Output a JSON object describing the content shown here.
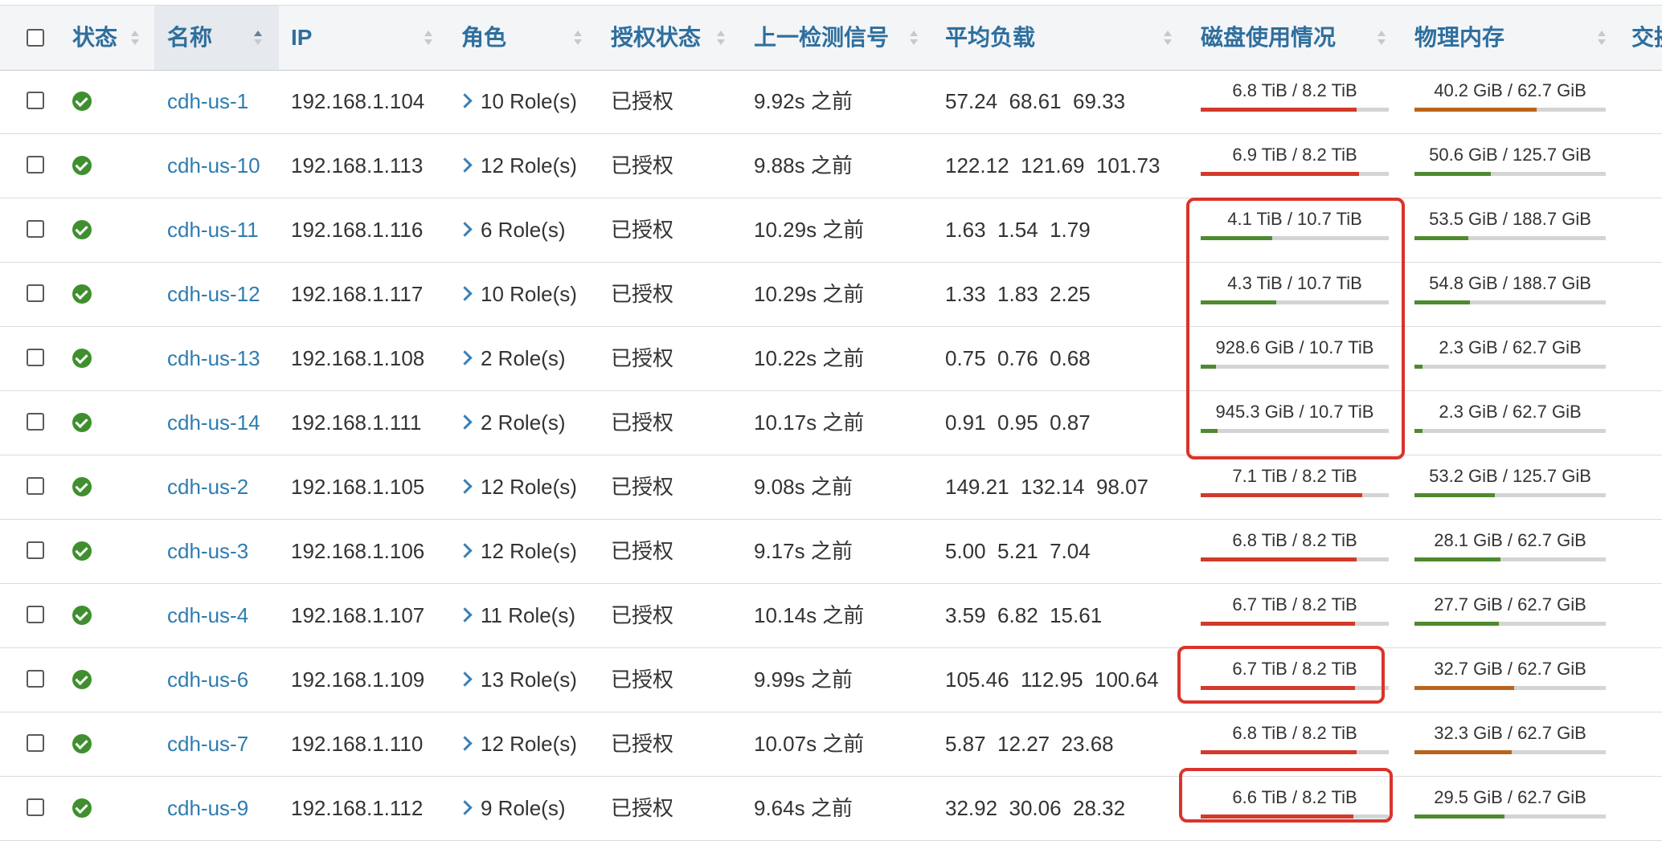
{
  "headers": {
    "status": "状态",
    "name": "名称",
    "ip": "IP",
    "role": "角色",
    "auth": "授权状态",
    "heartbeat": "上一检测信号",
    "load": "平均负载",
    "disk": "磁盘使用情况",
    "mem": "物理内存",
    "swap": "交换"
  },
  "colors": {
    "high": "#d33a2a",
    "mid": "#b8651c",
    "low": "#4e8a2f",
    "link": "#2e7cb0"
  },
  "rows": [
    {
      "name": "cdh-us-1",
      "ip": "192.168.1.104",
      "roles": "10 Role(s)",
      "auth": "已授权",
      "heartbeat": "9.92s 之前",
      "load": "57.24  68.61  69.33",
      "disk": "6.8 TiB / 8.2 TiB",
      "disk_pct": 0.83,
      "disk_color": "#d33a2a",
      "mem": "40.2 GiB / 62.7 GiB",
      "mem_pct": 0.64,
      "mem_color": "#b8651c"
    },
    {
      "name": "cdh-us-10",
      "ip": "192.168.1.113",
      "roles": "12 Role(s)",
      "auth": "已授权",
      "heartbeat": "9.88s 之前",
      "load": "122.12  121.69  101.73",
      "disk": "6.9 TiB / 8.2 TiB",
      "disk_pct": 0.84,
      "disk_color": "#d33a2a",
      "mem": "50.6 GiB / 125.7 GiB",
      "mem_pct": 0.4,
      "mem_color": "#4e8a2f"
    },
    {
      "name": "cdh-us-11",
      "ip": "192.168.1.116",
      "roles": "6 Role(s)",
      "auth": "已授权",
      "heartbeat": "10.29s 之前",
      "load": "1.63  1.54  1.79",
      "disk": "4.1 TiB / 10.7 TiB",
      "disk_pct": 0.38,
      "disk_color": "#4e8a2f",
      "mem": "53.5 GiB / 188.7 GiB",
      "mem_pct": 0.28,
      "mem_color": "#4e8a2f"
    },
    {
      "name": "cdh-us-12",
      "ip": "192.168.1.117",
      "roles": "10 Role(s)",
      "auth": "已授权",
      "heartbeat": "10.29s 之前",
      "load": "1.33  1.83  2.25",
      "disk": "4.3 TiB / 10.7 TiB",
      "disk_pct": 0.4,
      "disk_color": "#4e8a2f",
      "mem": "54.8 GiB / 188.7 GiB",
      "mem_pct": 0.29,
      "mem_color": "#4e8a2f"
    },
    {
      "name": "cdh-us-13",
      "ip": "192.168.1.108",
      "roles": "2 Role(s)",
      "auth": "已授权",
      "heartbeat": "10.22s 之前",
      "load": "0.75  0.76  0.68",
      "disk": "928.6 GiB / 10.7 TiB",
      "disk_pct": 0.08,
      "disk_color": "#4e8a2f",
      "mem": "2.3 GiB / 62.7 GiB",
      "mem_pct": 0.04,
      "mem_color": "#4e8a2f"
    },
    {
      "name": "cdh-us-14",
      "ip": "192.168.1.111",
      "roles": "2 Role(s)",
      "auth": "已授权",
      "heartbeat": "10.17s 之前",
      "load": "0.91  0.95  0.87",
      "disk": "945.3 GiB / 10.7 TiB",
      "disk_pct": 0.09,
      "disk_color": "#4e8a2f",
      "mem": "2.3 GiB / 62.7 GiB",
      "mem_pct": 0.04,
      "mem_color": "#4e8a2f"
    },
    {
      "name": "cdh-us-2",
      "ip": "192.168.1.105",
      "roles": "12 Role(s)",
      "auth": "已授权",
      "heartbeat": "9.08s 之前",
      "load": "149.21  132.14  98.07",
      "disk": "7.1 TiB / 8.2 TiB",
      "disk_pct": 0.86,
      "disk_color": "#d33a2a",
      "mem": "53.2 GiB / 125.7 GiB",
      "mem_pct": 0.42,
      "mem_color": "#4e8a2f"
    },
    {
      "name": "cdh-us-3",
      "ip": "192.168.1.106",
      "roles": "12 Role(s)",
      "auth": "已授权",
      "heartbeat": "9.17s 之前",
      "load": "5.00  5.21  7.04",
      "disk": "6.8 TiB / 8.2 TiB",
      "disk_pct": 0.83,
      "disk_color": "#d33a2a",
      "mem": "28.1 GiB / 62.7 GiB",
      "mem_pct": 0.45,
      "mem_color": "#4e8a2f"
    },
    {
      "name": "cdh-us-4",
      "ip": "192.168.1.107",
      "roles": "11 Role(s)",
      "auth": "已授权",
      "heartbeat": "10.14s 之前",
      "load": "3.59  6.82  15.61",
      "disk": "6.7 TiB / 8.2 TiB",
      "disk_pct": 0.82,
      "disk_color": "#d33a2a",
      "mem": "27.7 GiB / 62.7 GiB",
      "mem_pct": 0.44,
      "mem_color": "#4e8a2f"
    },
    {
      "name": "cdh-us-6",
      "ip": "192.168.1.109",
      "roles": "13 Role(s)",
      "auth": "已授权",
      "heartbeat": "9.99s 之前",
      "load": "105.46  112.95  100.64",
      "disk": "6.7 TiB / 8.2 TiB",
      "disk_pct": 0.82,
      "disk_color": "#d33a2a",
      "mem": "32.7 GiB / 62.7 GiB",
      "mem_pct": 0.52,
      "mem_color": "#b8651c"
    },
    {
      "name": "cdh-us-7",
      "ip": "192.168.1.110",
      "roles": "12 Role(s)",
      "auth": "已授权",
      "heartbeat": "10.07s 之前",
      "load": "5.87  12.27  23.68",
      "disk": "6.8 TiB / 8.2 TiB",
      "disk_pct": 0.83,
      "disk_color": "#d33a2a",
      "mem": "32.3 GiB / 62.7 GiB",
      "mem_pct": 0.51,
      "mem_color": "#b8651c"
    },
    {
      "name": "cdh-us-9",
      "ip": "192.168.1.112",
      "roles": "9 Role(s)",
      "auth": "已授权",
      "heartbeat": "9.64s 之前",
      "load": "32.92  30.06  28.32",
      "disk": "6.6 TiB / 8.2 TiB",
      "disk_pct": 0.81,
      "disk_color": "#d33a2a",
      "mem": "29.5 GiB / 62.7 GiB",
      "mem_pct": 0.47,
      "mem_color": "#4e8a2f"
    }
  ],
  "highlights": [
    "disk-rows-cdh-us-11-to-cdh-us-14",
    "disk-row-cdh-us-6",
    "disk-row-cdh-us-9"
  ]
}
